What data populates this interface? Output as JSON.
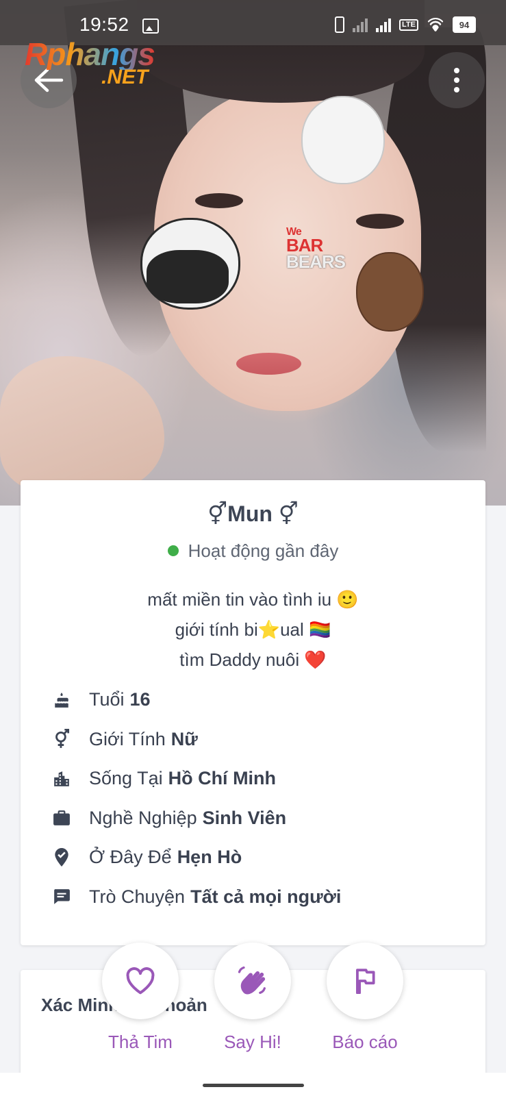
{
  "status_bar": {
    "time": "19:52",
    "battery": "94",
    "network_label": "LTE"
  },
  "watermark": {
    "line1": "Rphangs",
    "line2": ".NET"
  },
  "photo": {
    "sticker_text_top": "We",
    "sticker_text_mid": "BAR",
    "sticker_text_bot": "BEARS"
  },
  "profile": {
    "name": "⚥Mun ⚥",
    "status": "Hoạt động gần đây",
    "bio": [
      "mất miền tin vào tình iu 🙂",
      "giới tính bi⭐ual 🏳️‍🌈",
      "tìm Daddy nuôi ❤️"
    ],
    "details": [
      {
        "icon": "cake-icon",
        "label": "Tuổi",
        "value": "16"
      },
      {
        "icon": "gender-icon",
        "label": "Giới Tính",
        "value": "Nữ"
      },
      {
        "icon": "city-icon",
        "label": "Sống Tại",
        "value": "Hồ Chí Minh"
      },
      {
        "icon": "briefcase-icon",
        "label": "Nghề Nghiệp",
        "value": "Sinh Viên"
      },
      {
        "icon": "location-check-icon",
        "label": "Ở Đây Để",
        "value": "Hẹn Hò"
      },
      {
        "icon": "chat-icon",
        "label": "Trò Chuyện",
        "value": "Tất cả mọi người"
      }
    ]
  },
  "verification": {
    "title": "Xác Minh Tài khoản"
  },
  "actions": {
    "like": "Thả Tim",
    "hi": "Say Hi!",
    "report": "Báo cáo"
  },
  "colors": {
    "accent": "#9a58b8",
    "online": "#3fae49",
    "status_bar": "#464242"
  }
}
